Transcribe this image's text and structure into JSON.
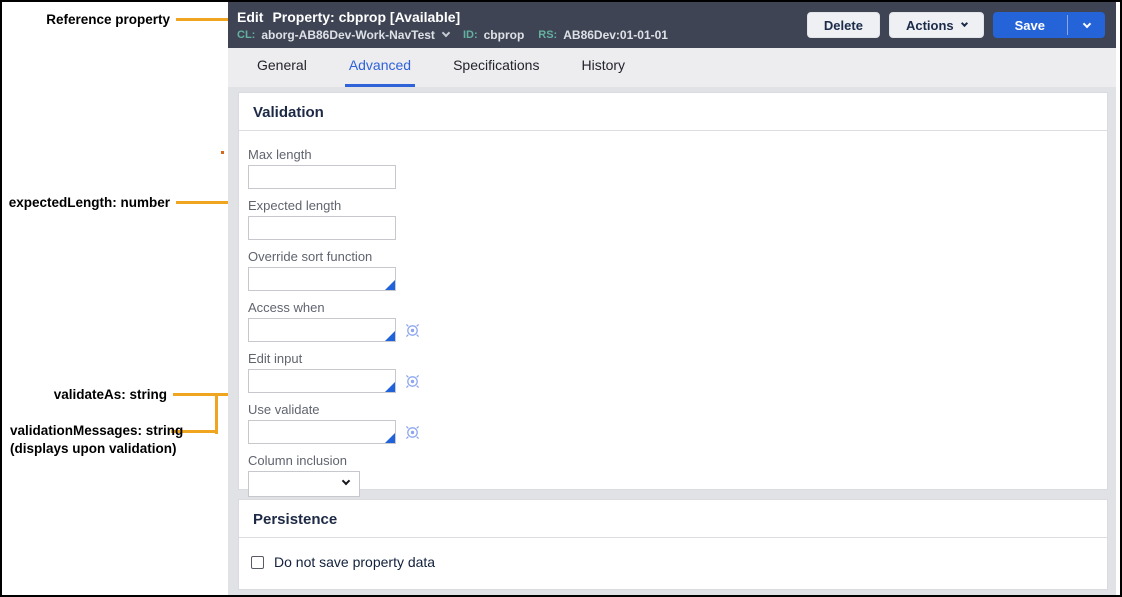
{
  "colors": {
    "accent_orange": "#EFA51F",
    "header_bg": "#3E4454",
    "primary_blue": "#2563D9",
    "teal_label": "#64B1A1"
  },
  "annotations": {
    "reference_property": "Reference property",
    "expected_length": "expectedLength: number",
    "validate_as": "validateAs: string",
    "validation_messages": "validationMessages: string",
    "validation_messages_note": "(displays upon validation)"
  },
  "header": {
    "mode": "Edit",
    "title": "Property: cbprop [Available]",
    "meta": [
      {
        "label": "CL:",
        "value": "aborg-AB86Dev-Work-NavTest"
      },
      {
        "label": "ID:",
        "value": "cbprop"
      },
      {
        "label": "RS:",
        "value": "AB86Dev:01-01-01"
      }
    ],
    "buttons": {
      "delete": "Delete",
      "actions": "Actions",
      "save": "Save"
    }
  },
  "tabs": [
    {
      "label": "General",
      "active": false
    },
    {
      "label": "Advanced",
      "active": true
    },
    {
      "label": "Specifications",
      "active": false
    },
    {
      "label": "History",
      "active": false
    }
  ],
  "sections": {
    "validation": {
      "title": "Validation",
      "fields": [
        {
          "label": "Max length",
          "value": "",
          "type": "text"
        },
        {
          "label": "Expected length",
          "value": "",
          "type": "text"
        },
        {
          "label": "Override sort function",
          "value": "",
          "type": "autocomplete"
        },
        {
          "label": "Access when",
          "value": "",
          "type": "autocomplete-with-target"
        },
        {
          "label": "Edit input",
          "value": "",
          "type": "autocomplete-with-target"
        },
        {
          "label": "Use validate",
          "value": "",
          "type": "autocomplete-with-target"
        },
        {
          "label": "Column inclusion",
          "value": "",
          "type": "select"
        }
      ]
    },
    "persistence": {
      "title": "Persistence",
      "checkbox": {
        "label": "Do not save property data",
        "checked": false
      }
    }
  }
}
